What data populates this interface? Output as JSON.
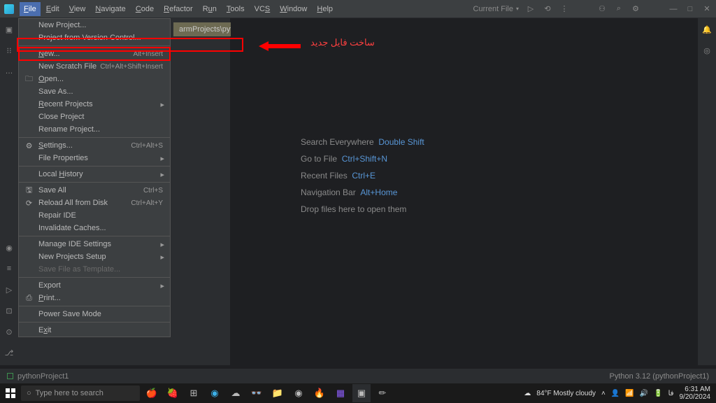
{
  "menubar": {
    "items": [
      "File",
      "Edit",
      "View",
      "Navigate",
      "Code",
      "Refactor",
      "Run",
      "Tools",
      "VCS",
      "Window",
      "Help"
    ],
    "currentFile": "Current File"
  },
  "dropdown": [
    {
      "label": "New Project...",
      "type": "item"
    },
    {
      "label": "Project from Version Control...",
      "type": "item"
    },
    {
      "type": "sep"
    },
    {
      "label": "New...",
      "shortcut": "Alt+Insert",
      "type": "highlight",
      "u": "N"
    },
    {
      "label": "New Scratch File",
      "shortcut": "Ctrl+Alt+Shift+Insert",
      "type": "item"
    },
    {
      "label": "Open...",
      "icon": "folder",
      "type": "item",
      "u": "O"
    },
    {
      "label": "Save As...",
      "type": "item"
    },
    {
      "label": "Recent Projects",
      "arrow": true,
      "type": "item",
      "u": "R"
    },
    {
      "label": "Close Project",
      "type": "item"
    },
    {
      "label": "Rename Project...",
      "type": "item"
    },
    {
      "type": "sep"
    },
    {
      "label": "Settings...",
      "shortcut": "Ctrl+Alt+S",
      "icon": "gear",
      "type": "item",
      "u": "S"
    },
    {
      "label": "File Properties",
      "arrow": true,
      "type": "item"
    },
    {
      "type": "sep"
    },
    {
      "label": "Local History",
      "arrow": true,
      "type": "item",
      "u": "H"
    },
    {
      "type": "sep"
    },
    {
      "label": "Save All",
      "shortcut": "Ctrl+S",
      "icon": "save",
      "type": "item"
    },
    {
      "label": "Reload All from Disk",
      "shortcut": "Ctrl+Alt+Y",
      "icon": "reload",
      "type": "item"
    },
    {
      "label": "Repair IDE",
      "type": "item"
    },
    {
      "label": "Invalidate Caches...",
      "type": "item"
    },
    {
      "type": "sep"
    },
    {
      "label": "Manage IDE Settings",
      "arrow": true,
      "type": "item"
    },
    {
      "label": "New Projects Setup",
      "arrow": true,
      "type": "item"
    },
    {
      "label": "Save File as Template...",
      "type": "disabled"
    },
    {
      "type": "sep"
    },
    {
      "label": "Export",
      "arrow": true,
      "type": "item"
    },
    {
      "label": "Print...",
      "icon": "print",
      "type": "item",
      "u": "P"
    },
    {
      "type": "sep"
    },
    {
      "label": "Power Save Mode",
      "type": "item"
    },
    {
      "type": "sep"
    },
    {
      "label": "Exit",
      "type": "item",
      "u": "x"
    }
  ],
  "annotation": {
    "text": "ساخت فایل جدید"
  },
  "welcome": [
    {
      "label": "Search Everywhere",
      "sc": "Double Shift"
    },
    {
      "label": "Go to File",
      "sc": "Ctrl+Shift+N"
    },
    {
      "label": "Recent Files",
      "sc": "Ctrl+E"
    },
    {
      "label": "Navigation Bar",
      "sc": "Alt+Home"
    },
    {
      "label": "Drop files here to open them",
      "sc": ""
    }
  ],
  "projectTab": "armProjects\\pythonPr",
  "status": {
    "project": "pythonProject1",
    "right": "Python 3.12 (pythonProject1)"
  },
  "taskbar": {
    "search": "Type here to search",
    "weather": "84°F Mostly cloudy",
    "time": "6:31 AM",
    "date": "9/20/2024"
  }
}
